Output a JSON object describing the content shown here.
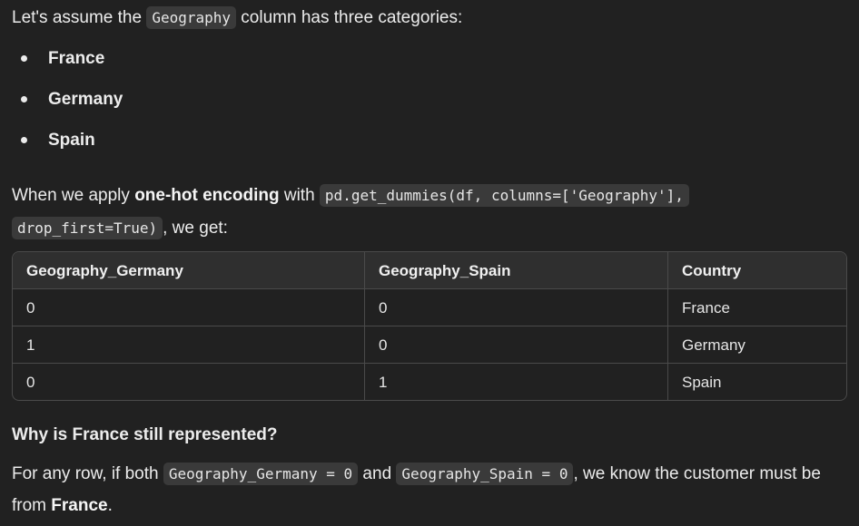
{
  "intro": {
    "prefix": "Let's assume the ",
    "code": "Geography",
    "suffix": " column has three categories:"
  },
  "categories": [
    "France",
    "Germany",
    "Spain"
  ],
  "apply": {
    "prefix": "When we apply ",
    "bold": "one-hot encoding",
    "middle": " with ",
    "code1": "pd.get_dummies(df, columns=['Geography'],",
    "code2": "drop_first=True)",
    "suffix": ", we get:"
  },
  "table": {
    "headers": [
      "Geography_Germany",
      "Geography_Spain",
      "Country"
    ],
    "rows": [
      [
        "0",
        "0",
        "France"
      ],
      [
        "1",
        "0",
        "Germany"
      ],
      [
        "0",
        "1",
        "Spain"
      ]
    ]
  },
  "question": "Why is France still represented?",
  "answer": {
    "prefix": "For any row, if both ",
    "code1": "Geography_Germany = 0",
    "middle": " and ",
    "code2": "Geography_Spain = 0",
    "suffix": ", we know the customer must be from ",
    "bold": "France",
    "end": "."
  }
}
